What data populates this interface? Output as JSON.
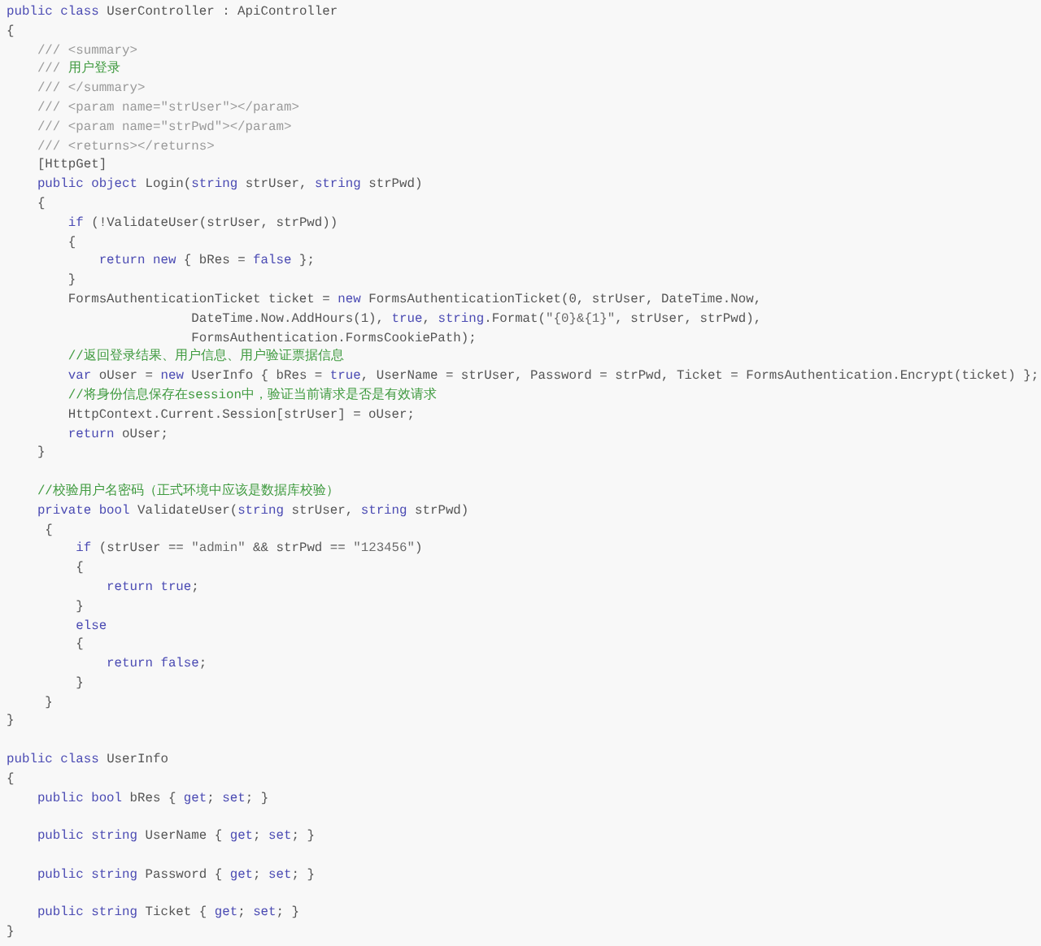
{
  "code_blocks": [
    {
      "lines": [
        [
          {
            "kind": "kw",
            "text": "public class"
          },
          {
            "kind": "plain",
            "text": " UserController : ApiController"
          }
        ],
        [
          {
            "kind": "plain",
            "text": "{"
          }
        ],
        [
          {
            "kind": "doc",
            "text": "    /// <summary>"
          }
        ],
        [
          {
            "kind": "doc",
            "text": "    /// "
          },
          {
            "kind": "comment",
            "text": "用户登录"
          }
        ],
        [
          {
            "kind": "doc",
            "text": "    /// </summary>"
          }
        ],
        [
          {
            "kind": "doc",
            "text": "    /// <param name=\"strUser\"></param>"
          }
        ],
        [
          {
            "kind": "doc",
            "text": "    /// <param name=\"strPwd\"></param>"
          }
        ],
        [
          {
            "kind": "doc",
            "text": "    /// <returns></returns>"
          }
        ],
        [
          {
            "kind": "plain",
            "text": "    [HttpGet]"
          }
        ],
        [
          {
            "kind": "kw",
            "text": "    public object"
          },
          {
            "kind": "plain",
            "text": " Login("
          },
          {
            "kind": "kw",
            "text": "string"
          },
          {
            "kind": "plain",
            "text": " strUser, "
          },
          {
            "kind": "kw",
            "text": "string"
          },
          {
            "kind": "plain",
            "text": " strPwd)"
          }
        ],
        [
          {
            "kind": "plain",
            "text": "    {"
          }
        ],
        [
          {
            "kind": "kw",
            "text": "        if"
          },
          {
            "kind": "plain",
            "text": " (!ValidateUser(strUser, strPwd))"
          }
        ],
        [
          {
            "kind": "plain",
            "text": "        {"
          }
        ],
        [
          {
            "kind": "kw",
            "text": "            return new"
          },
          {
            "kind": "plain",
            "text": " { bRes = "
          },
          {
            "kind": "kw",
            "text": "false"
          },
          {
            "kind": "plain",
            "text": " };"
          }
        ],
        [
          {
            "kind": "plain",
            "text": "        }"
          }
        ],
        [
          {
            "kind": "plain",
            "text": "        FormsAuthenticationTicket ticket = "
          },
          {
            "kind": "kw",
            "text": "new"
          },
          {
            "kind": "plain",
            "text": " FormsAuthenticationTicket(0, strUser, DateTime.Now,"
          }
        ],
        [
          {
            "kind": "plain",
            "text": "                        DateTime.Now.AddHours(1), "
          },
          {
            "kind": "kw",
            "text": "true"
          },
          {
            "kind": "plain",
            "text": ", "
          },
          {
            "kind": "kw",
            "text": "string"
          },
          {
            "kind": "plain",
            "text": ".Format("
          },
          {
            "kind": "str",
            "text": "\"{0}&{1}\""
          },
          {
            "kind": "plain",
            "text": ", strUser, strPwd),"
          }
        ],
        [
          {
            "kind": "plain",
            "text": "                        FormsAuthentication.FormsCookiePath);"
          }
        ],
        [
          {
            "kind": "comment",
            "text": "        //返回登录结果、用户信息、用户验证票据信息"
          }
        ],
        [
          {
            "kind": "kw",
            "text": "        var"
          },
          {
            "kind": "plain",
            "text": " oUser = "
          },
          {
            "kind": "kw",
            "text": "new"
          },
          {
            "kind": "plain",
            "text": " UserInfo { bRes = "
          },
          {
            "kind": "kw",
            "text": "true"
          },
          {
            "kind": "plain",
            "text": ", UserName = strUser, Password = strPwd, Ticket = FormsAuthentication.Encrypt(ticket) };"
          }
        ],
        [
          {
            "kind": "comment",
            "text": "        //将身份信息保存在session中，验证当前请求是否是有效请求"
          }
        ],
        [
          {
            "kind": "plain",
            "text": "        HttpContext.Current.Session[strUser] = oUser;"
          }
        ],
        [
          {
            "kind": "kw",
            "text": "        return"
          },
          {
            "kind": "plain",
            "text": " oUser;"
          }
        ],
        [
          {
            "kind": "plain",
            "text": "    }"
          }
        ]
      ]
    },
    {
      "lines": [
        [
          {
            "kind": "comment",
            "text": "    //校验用户名密码（正式环境中应该是数据库校验）"
          }
        ],
        [
          {
            "kind": "kw",
            "text": "    private bool"
          },
          {
            "kind": "plain",
            "text": " ValidateUser("
          },
          {
            "kind": "kw",
            "text": "string"
          },
          {
            "kind": "plain",
            "text": " strUser, "
          },
          {
            "kind": "kw",
            "text": "string"
          },
          {
            "kind": "plain",
            "text": " strPwd)"
          }
        ],
        [
          {
            "kind": "plain",
            "text": "     {"
          }
        ],
        [
          {
            "kind": "kw",
            "text": "         if"
          },
          {
            "kind": "plain",
            "text": " (strUser == "
          },
          {
            "kind": "str",
            "text": "\"admin\""
          },
          {
            "kind": "plain",
            "text": " && strPwd == "
          },
          {
            "kind": "str",
            "text": "\"123456\""
          },
          {
            "kind": "plain",
            "text": ")"
          }
        ],
        [
          {
            "kind": "plain",
            "text": "         {"
          }
        ],
        [
          {
            "kind": "kw",
            "text": "             return true"
          },
          {
            "kind": "plain",
            "text": ";"
          }
        ],
        [
          {
            "kind": "plain",
            "text": "         }"
          }
        ],
        [
          {
            "kind": "kw",
            "text": "         else"
          }
        ],
        [
          {
            "kind": "plain",
            "text": "         {"
          }
        ],
        [
          {
            "kind": "kw",
            "text": "             return false"
          },
          {
            "kind": "plain",
            "text": ";"
          }
        ],
        [
          {
            "kind": "plain",
            "text": "         }"
          }
        ],
        [
          {
            "kind": "plain",
            "text": "     }"
          }
        ],
        [
          {
            "kind": "plain",
            "text": "}"
          }
        ]
      ]
    },
    {
      "lines": [
        [
          {
            "kind": "kw",
            "text": "public class"
          },
          {
            "kind": "plain",
            "text": " UserInfo"
          }
        ],
        [
          {
            "kind": "plain",
            "text": "{"
          }
        ],
        [
          {
            "kind": "kw",
            "text": "    public bool"
          },
          {
            "kind": "plain",
            "text": " bRes { "
          },
          {
            "kind": "kw",
            "text": "get"
          },
          {
            "kind": "plain",
            "text": "; "
          },
          {
            "kind": "kw",
            "text": "set"
          },
          {
            "kind": "plain",
            "text": "; }"
          }
        ]
      ]
    },
    {
      "lines": [
        [
          {
            "kind": "kw",
            "text": "    public string"
          },
          {
            "kind": "plain",
            "text": " UserName { "
          },
          {
            "kind": "kw",
            "text": "get"
          },
          {
            "kind": "plain",
            "text": "; "
          },
          {
            "kind": "kw",
            "text": "set"
          },
          {
            "kind": "plain",
            "text": "; }"
          }
        ]
      ]
    },
    {
      "lines": [
        [
          {
            "kind": "kw",
            "text": "    public string"
          },
          {
            "kind": "plain",
            "text": " Password { "
          },
          {
            "kind": "kw",
            "text": "get"
          },
          {
            "kind": "plain",
            "text": "; "
          },
          {
            "kind": "kw",
            "text": "set"
          },
          {
            "kind": "plain",
            "text": "; }"
          }
        ]
      ]
    },
    {
      "lines": [
        [
          {
            "kind": "kw",
            "text": "    public string"
          },
          {
            "kind": "plain",
            "text": " Ticket { "
          },
          {
            "kind": "kw",
            "text": "get"
          },
          {
            "kind": "plain",
            "text": "; "
          },
          {
            "kind": "kw",
            "text": "set"
          },
          {
            "kind": "plain",
            "text": "; }"
          }
        ],
        [
          {
            "kind": "plain",
            "text": "}"
          }
        ]
      ]
    }
  ]
}
